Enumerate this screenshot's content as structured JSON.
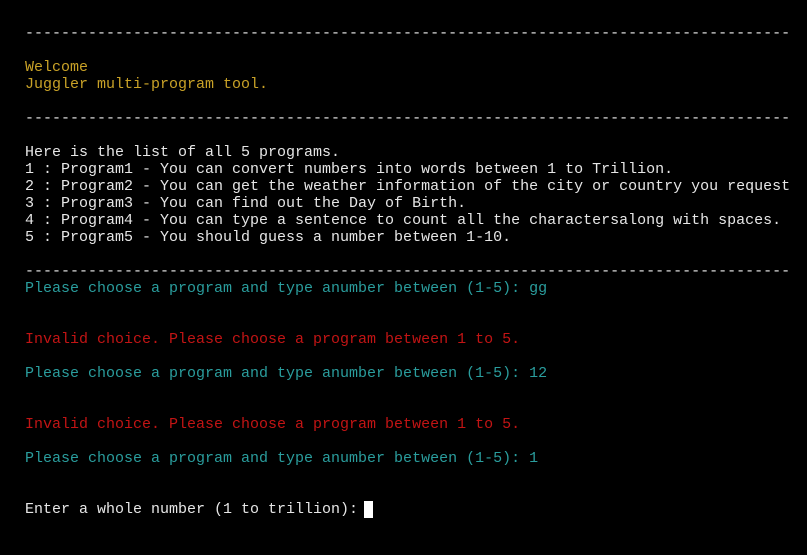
{
  "divider": "-------------------------------------------------------------------------------------",
  "header": {
    "welcome": "Welcome",
    "subtitle": "Juggler multi-program tool."
  },
  "programs": {
    "intro": "Here is the list of all 5 programs.",
    "items": [
      "1 : Program1 - You can convert numbers into words between 1 to Trillion.",
      "2 : Program2 - You can get the weather information of the city or country you request",
      "3 : Program3 - You can find out the Day of Birth.",
      "4 : Program4 - You can type a sentence to count all the charactersalong with spaces.",
      "5 : Program5 - You should guess a number between 1-10."
    ]
  },
  "session": {
    "prompt1": "Please choose a program and type anumber between (1-5): gg",
    "error1": "Invalid choice. Please choose a program between 1 to 5.",
    "prompt2": "Please choose a program and type anumber between (1-5): 12",
    "error2": "Invalid choice. Please choose a program between 1 to 5.",
    "prompt3": "Please choose a program and type anumber between (1-5): 1",
    "input_prompt": "Enter a whole number (1 to trillion):"
  },
  "colors": {
    "header": "#c9a227",
    "prompt": "#2a9d9d",
    "error": "#c21414",
    "text": "#e6e6e6"
  }
}
